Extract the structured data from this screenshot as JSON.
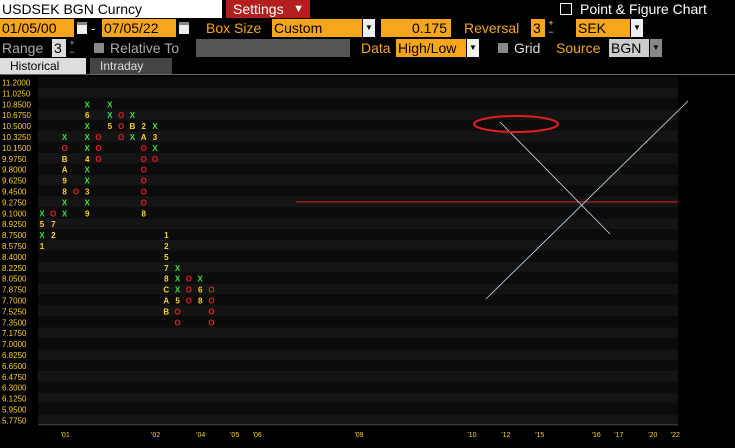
{
  "header": {
    "ticker": "USDSEK BGN Curncy",
    "settings_label": "Settings",
    "chart_title": "Point & Figure Chart"
  },
  "controls": {
    "start_date": "01/05/00",
    "date_separator": "-",
    "end_date": "07/05/22",
    "box_size_label": "Box Size",
    "box_size_value": "Custom",
    "box_size_amount": "0.175",
    "reversal_label": "Reversal",
    "reversal_value": "3",
    "currency_value": "SEK",
    "range_label": "Range",
    "range_value": "3",
    "relative_to_label": "Relative To",
    "data_label": "Data",
    "data_value": "High/Low",
    "grid_label": "Grid",
    "source_label": "Source",
    "source_value": "BGN"
  },
  "tabs": [
    {
      "label": "Historical",
      "active": true
    },
    {
      "label": "Intraday",
      "active": false
    }
  ],
  "colors": {
    "accent": "#f7a61c",
    "x_color": "#3be03b",
    "o_color": "#e02020",
    "digit_color": "#ffd21a",
    "settings_bg": "#b51e1e",
    "ellipse": "#e02020",
    "resistance_line": "#e02020",
    "trendline": "#c8e6f5"
  },
  "chart_data": {
    "type": "point-and-figure",
    "y_ticks": [
      "11.2000",
      "11.0250",
      "10.8500",
      "10.6750",
      "10.5000",
      "10.3250",
      "10.1500",
      "9.9750",
      "9.8000",
      "9.6250",
      "9.4500",
      "9.2750",
      "9.1000",
      "8.9250",
      "8.7500",
      "8.5750",
      "8.4000",
      "8.2250",
      "8.0500",
      "7.8750",
      "7.7000",
      "7.5250",
      "7.3500",
      "7.1750",
      "7.0000",
      "6.8250",
      "6.6500",
      "6.4750",
      "6.3000",
      "6.1250",
      "5.9500",
      "5.7750"
    ],
    "x_ticks": [
      {
        "label": "'01",
        "col": 2
      },
      {
        "label": "'02",
        "col": 10
      },
      {
        "label": "'04",
        "col": 14
      },
      {
        "label": "'05",
        "col": 17
      },
      {
        "label": "'06",
        "col": 19
      },
      {
        "label": "'09",
        "col": 28
      },
      {
        "label": "'10",
        "col": 38
      },
      {
        "label": "'12",
        "col": 41
      },
      {
        "label": "'15",
        "col": 44
      },
      {
        "label": "'16",
        "col": 49
      },
      {
        "label": "'17",
        "col": 51
      },
      {
        "label": "'20",
        "col": 54
      },
      {
        "label": "'22",
        "col": 56
      }
    ],
    "box_size": 0.175,
    "reversal": 3,
    "resistance_level": 9.275,
    "columns": [
      {
        "type": "X",
        "top": 9.1,
        "cells": "X5X1"
      },
      {
        "type": "O",
        "top": 9.1,
        "cells": "O72"
      },
      {
        "type": "X",
        "top": 10.325,
        "cells": "XOBA98XX"
      },
      {
        "type": "O",
        "top": 9.45,
        "cells": "O"
      },
      {
        "type": "X",
        "top": 10.85,
        "cells": "X6XXX4XX3X9"
      },
      {
        "type": "O",
        "top": 10.325,
        "cells": "OOO"
      },
      {
        "type": "X",
        "top": 10.85,
        "cells": "XX5"
      },
      {
        "type": "O",
        "top": 10.675,
        "cells": "OOO"
      },
      {
        "type": "X",
        "top": 10.675,
        "cells": "XBX"
      },
      {
        "type": "O",
        "top": 10.5,
        "cells": "2AOOOOOO8"
      },
      {
        "type": "X",
        "top": 10.5,
        "cells": "X3XO"
      },
      {
        "type": "O",
        "top": 8.75,
        "cells": "12578CAB"
      },
      {
        "type": "X",
        "top": 8.225,
        "cells": "XXX5OO"
      },
      {
        "type": "O",
        "top": 8.05,
        "cells": "OOO"
      },
      {
        "type": "X",
        "top": 8.05,
        "cells": "X68"
      },
      {
        "type": "O",
        "top": 7.875,
        "cells": "OOOO"
      }
    ]
  }
}
